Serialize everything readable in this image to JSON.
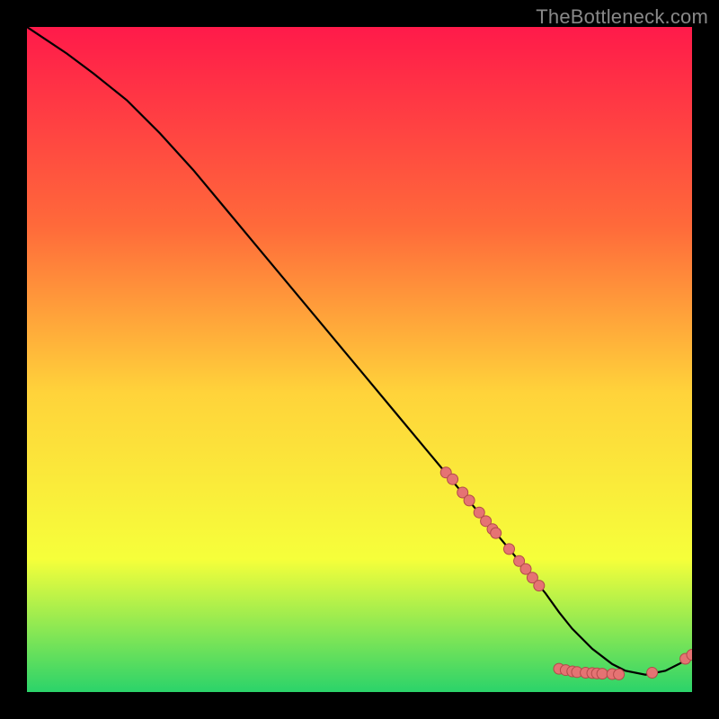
{
  "watermark": "TheBottleneck.com",
  "colors": {
    "background_black": "#000000",
    "curve": "#000000",
    "marker_fill": "#e57373",
    "marker_stroke": "#b24a4a",
    "gradient_top": "#ff1a4a",
    "gradient_mid_upper": "#ff6a3a",
    "gradient_mid": "#ffd33a",
    "gradient_lower": "#f6ff3a",
    "gradient_bottom": "#2bd36a"
  },
  "chart_data": {
    "type": "line",
    "title": "",
    "xlabel": "",
    "ylabel": "",
    "xlim": [
      0,
      100
    ],
    "ylim": [
      0,
      100
    ],
    "grid": false,
    "legend": false,
    "series": [
      {
        "name": "curve",
        "x": [
          0,
          3,
          6,
          10,
          15,
          20,
          25,
          30,
          35,
          40,
          45,
          50,
          55,
          60,
          65,
          70,
          75,
          78,
          80,
          82,
          85,
          88,
          90,
          93,
          96,
          98,
          100
        ],
        "y": [
          100,
          98,
          96,
          93,
          89,
          84,
          78.5,
          72.5,
          66.5,
          60.5,
          54.5,
          48.5,
          42.5,
          36.5,
          30.5,
          24.5,
          18.5,
          14.8,
          12,
          9.5,
          6.5,
          4.2,
          3.2,
          2.6,
          3.2,
          4.2,
          5.3
        ]
      }
    ],
    "markers": [
      {
        "x": 63,
        "y": 33
      },
      {
        "x": 64,
        "y": 32
      },
      {
        "x": 65.5,
        "y": 30
      },
      {
        "x": 66.5,
        "y": 28.8
      },
      {
        "x": 68,
        "y": 27
      },
      {
        "x": 69,
        "y": 25.7
      },
      {
        "x": 70,
        "y": 24.5
      },
      {
        "x": 70.5,
        "y": 23.9
      },
      {
        "x": 72.5,
        "y": 21.5
      },
      {
        "x": 74,
        "y": 19.7
      },
      {
        "x": 75,
        "y": 18.5
      },
      {
        "x": 76,
        "y": 17.2
      },
      {
        "x": 77,
        "y": 16
      },
      {
        "x": 80,
        "y": 3.5
      },
      {
        "x": 81,
        "y": 3.3
      },
      {
        "x": 82,
        "y": 3.1
      },
      {
        "x": 82.7,
        "y": 3.0
      },
      {
        "x": 84,
        "y": 2.9
      },
      {
        "x": 85,
        "y": 2.85
      },
      {
        "x": 85.7,
        "y": 2.8
      },
      {
        "x": 86.5,
        "y": 2.75
      },
      {
        "x": 88,
        "y": 2.7
      },
      {
        "x": 89,
        "y": 2.65
      },
      {
        "x": 94,
        "y": 2.9
      },
      {
        "x": 99,
        "y": 5.0
      },
      {
        "x": 100,
        "y": 5.6
      }
    ]
  }
}
